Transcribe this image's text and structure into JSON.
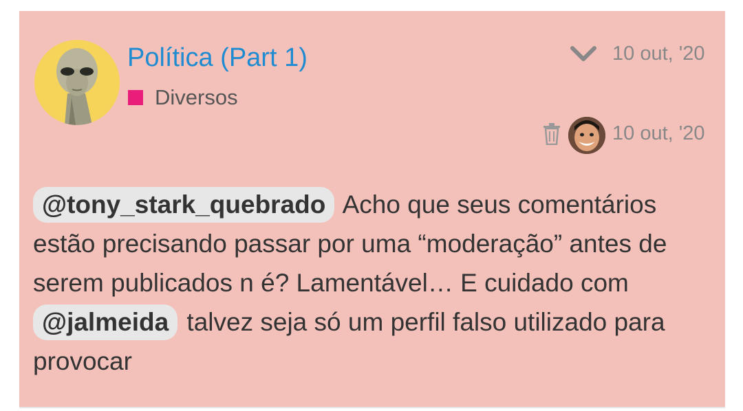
{
  "post": {
    "title": "Política (Part 1)",
    "category": "Diversos",
    "category_color": "#e91e7b",
    "date_posted": "10 out, '20",
    "date_edited": "10 out, '20",
    "body": {
      "mention1": "@tony_stark_quebrado",
      "text1": " Acho que seus comentários estão precisando passar por uma “moderação” antes de serem publicados n é? Lamentável… E cuidado com ",
      "mention2": "@jalmeida",
      "text2": " talvez seja só um perfil falso utilizado para provocar"
    }
  },
  "icons": {
    "expand": "chevron-down-icon",
    "delete": "trash-icon"
  },
  "colors": {
    "card_background": "#f4c1ba",
    "title": "#1f8bd1",
    "avatar_background": "#f6d45a"
  }
}
